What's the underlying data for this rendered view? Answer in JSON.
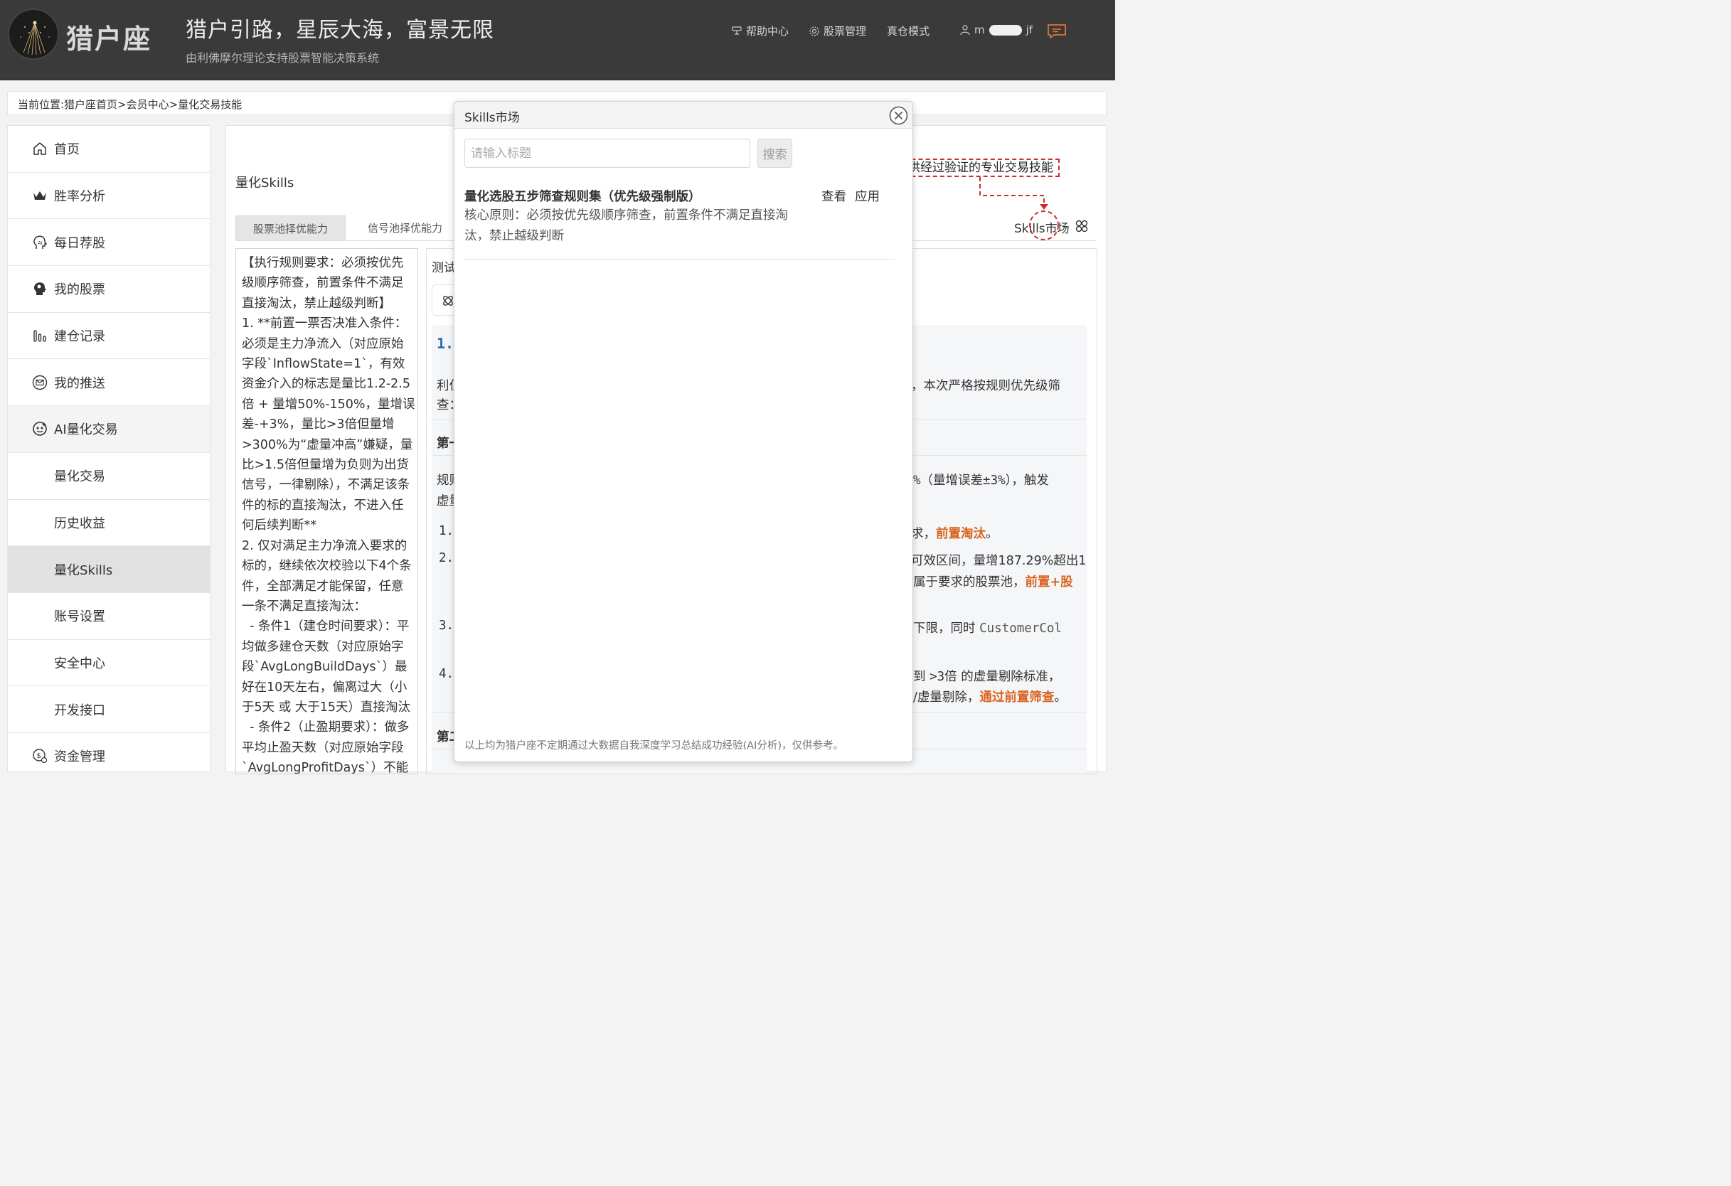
{
  "header": {
    "logo_text": "猎户座",
    "slogan": "猎户引路，星辰大海，富景无限",
    "sub_slogan": "由利佛摩尔理论支持股票智能决策系统",
    "nav": {
      "help": "帮助中心",
      "stock_manage": "股票管理",
      "real_mode": "真仓模式",
      "user_prefix": "m",
      "user_suffix": "jf"
    },
    "icons": [
      "help-icon",
      "gear-icon",
      "user-icon",
      "message-icon"
    ]
  },
  "breadcrumb": "当前位置:猎户座首页>会员中心>量化交易技能",
  "sidebar": {
    "items": [
      {
        "label": "首页",
        "icon": "home-icon"
      },
      {
        "label": "胜率分析",
        "icon": "crown-icon"
      },
      {
        "label": "每日荐股",
        "icon": "ai-head-icon"
      },
      {
        "label": "我的股票",
        "icon": "brain-head-icon"
      },
      {
        "label": "建仓记录",
        "icon": "bar-chart-icon"
      },
      {
        "label": "我的推送",
        "icon": "envelope-icon"
      },
      {
        "label": "AI量化交易",
        "icon": "robot-face-icon"
      },
      {
        "label": "量化交易"
      },
      {
        "label": "历史收益"
      },
      {
        "label": "量化Skills"
      },
      {
        "label": "账号设置"
      },
      {
        "label": "安全中心"
      },
      {
        "label": "开发接口"
      },
      {
        "label": "资金管理",
        "icon": "money-icon"
      }
    ],
    "active": "量化Skills"
  },
  "main": {
    "title": "量化Skills",
    "tabs": [
      "股票池择优能力",
      "信号池择优能力"
    ],
    "active_tab": "股票池择优能力",
    "skills_link": "Skills市场",
    "callout": "提供经过验证的专业交易技能",
    "rules_text": "【执行规则要求：必须按优先级顺序筛查，前置条件不满足直接淘汰，禁止越级判断】\n1. **前置一票否决准入条件：必须是主力净流入（对应原始字段`InflowState=1`，有效资金介入的标志是量比1.2-2.5倍 + 量增50%-150%，量增误差-+3%，量比>3倍但量增>300%为“虚量冲高”嫌疑，量比>1.5倍但量增为负则为出货信号，一律剔除），不满足该条件的标的直接淘汰，不进入任何后续判断**\n2. 仅对满足主力净流入要求的标的，继续依次校验以下4个条件，全部满足才能保留，任意一条不满足直接淘汰：\n  - 条件1（建仓时间要求）：平均做多建仓天数（对应原始字段`AvgLongBuildDays`）最好在10天左右，偏离过大（小于5天 或 大于15天）直接淘汰\n  - 条件2（止盈期要求）：做多平均止盈天数（对应原始字段`AvgLongProfitDays`）不能",
    "test_label": "测试",
    "result": {
      "h1_num": "1.",
      "line1_left": "利仁",
      "line1_right": "，本次严格按规则优先级筛",
      "line2_left": "查：",
      "section1": "第一",
      "rule_left": "规则",
      "rule_mid_mono": "%",
      "rule_right": "（量增误差",
      "rule_right_mono": "±3%",
      "rule_right2": "），触发",
      "rule2_left": "虚量",
      "item1_num": "1.",
      "item1_text": "求，",
      "item1_hl": "前置淘汰",
      "item1_end": "。",
      "item2_num": "2.",
      "item2_text": "可效区间，量增187.29%超出1",
      "item2b_text": "属于要求的股票池，",
      "item2b_hl": "前置+股",
      "item3_num": "3.",
      "item3_text": "下限，同时",
      "item3_mono": "CustomerCol",
      "item4_num": "4.",
      "item4_text": "到",
      "item4_mono": ">3",
      "item4_text2": "倍 的虚量剔除标准，",
      "item4b_text": "/虚量剔除，",
      "item4b_hl": "通过前置筛查",
      "item4b_end": "。",
      "section2": "第二"
    }
  },
  "modal": {
    "title": "Skills市场",
    "search_placeholder": "请输入标题",
    "search_button": "搜索",
    "skill": {
      "title": "量化选股五步筛查规则集（优先级强制版）",
      "view": "查看",
      "apply": "应用",
      "desc": "核心原则：必须按优先级顺序筛查，前置条件不满足直接淘汰，禁止越级判断"
    },
    "footer": "以上均为猎户座不定期通过大数据自我深度学习总结成功经验(AI分析)，仅供参考。"
  },
  "colors": {
    "header_bg": "#3a3a3a",
    "accent_orange": "#d9631e",
    "callout_red": "#c92e2e",
    "heading_blue": "#2a6fb5"
  }
}
